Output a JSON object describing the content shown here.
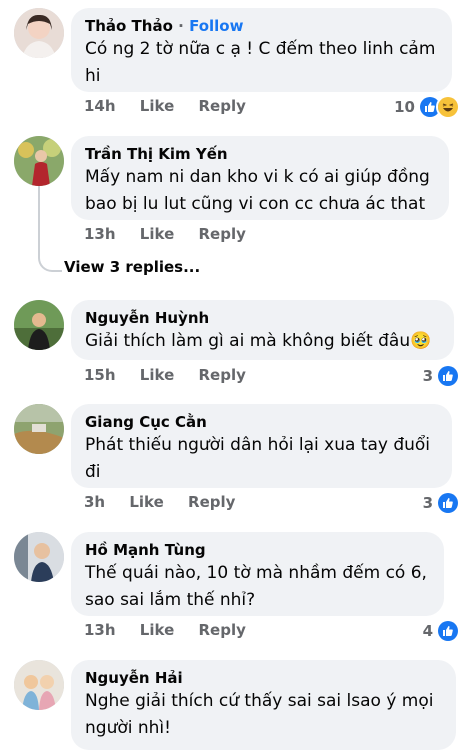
{
  "comments": [
    {
      "name": "Thảo Thảo",
      "separator": "·",
      "follow": "Follow",
      "text": "Có ng 2 tờ nữa c ạ ! C đếm theo linh cảm\nhi",
      "time": "14h",
      "like": "Like",
      "reply": "Reply",
      "reaction_count": "10"
    },
    {
      "name": "Trần Thị Kim Yến",
      "text": "Mấy nam ni dan kho vi k có ai giúp đồng\nbao bị lu lut cũng vi con cc chưa ác that",
      "time": "13h",
      "like": "Like",
      "reply": "Reply"
    },
    {
      "name": "Nguyễn Huỳnh",
      "text": "Giải thích làm gì ai mà không biết đâu🥹",
      "time": "15h",
      "like": "Like",
      "reply": "Reply",
      "reaction_count": "3"
    },
    {
      "name": "Giang Cục Cằn",
      "text": "Phát thiếu người dân hỏi lại xua tay đuổi\nđi",
      "time": "3h",
      "like": "Like",
      "reply": "Reply",
      "reaction_count": "3"
    },
    {
      "name": "Hồ Mạnh Tùng",
      "text": "Thế quái nào, 10 tờ mà nhầm đếm có 6,\nsao sai lắm thế nhỉ?",
      "time": "13h",
      "like": "Like",
      "reply": "Reply",
      "reaction_count": "4"
    },
    {
      "name": "Nguyễn Hải",
      "text": "Nghe giải thích cứ thấy sai sai lsao ý mọi\nngười nhì!"
    }
  ],
  "view_replies": "View 3 replies...",
  "colors": {
    "like_blue": "#1877f2",
    "bubble": "#f0f2f5",
    "meta": "#65676b"
  },
  "icons": [
    "like-icon",
    "haha-icon"
  ]
}
